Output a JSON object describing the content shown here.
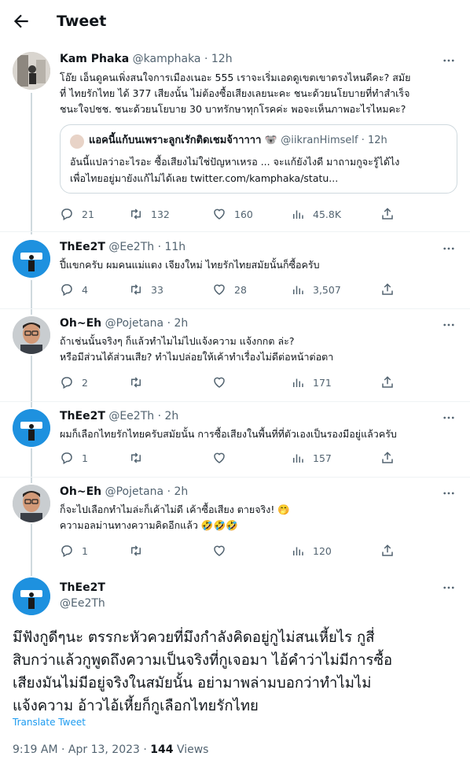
{
  "header": {
    "title": "Tweet"
  },
  "tweets": [
    {
      "name": "Kam Phaka",
      "handle": "@kamphaka",
      "time": "12h",
      "lines": [
        "โอ๊ย เอ็นดูคนเพิ่งสนใจการเมืองเนอะ 555 เราจะเริ่มเอดดูเขตเขาตรงไหนดีคะ? สมัย",
        "ที่ ไทยรักไทย ได้ 377 เสียงนั้น ไม่ต้องซื้อเสียงเลยนะคะ ชนะด้วยนโยบายที่ทำสำเร็จ",
        "ชนะใจปชช. ชนะด้วยนโยบาย 30 บาทรักษาทุกโรคค่ะ พอจะเห็นภาพอะไรไหมคะ?"
      ],
      "quote": {
        "name": "แอคนี้แก้บนเพราะลูกเรักติดเชมจ้าาาาา 🐨",
        "handle": "@iikranHimself",
        "time": "12h",
        "lines": [
          "อันนี้แปลว่าอะไรอะ ซื้อเสียงไม่ใช่ปัญหาเหรอ ... จะแก้ยังไงดี มาถามกูจะรู้ได้ไง",
          "เพื่อไทยอยู่มายังแก้ไม่ได้เลย twitter.com/kamphaka/statu..."
        ]
      },
      "replies": "21",
      "retweets": "132",
      "likes": "160",
      "views": "45.8K"
    },
    {
      "name": "ThEe2T",
      "handle": "@Ee2Th",
      "time": "11h",
      "lines": [
        "ปี้แขกครับ ผมคนแม่แตง เจียงใหม่ ไทยรักไทยสมัยนั้นก็ซื้อครับ"
      ],
      "replies": "4",
      "retweets": "33",
      "likes": "28",
      "views": "3,507"
    },
    {
      "name": "Oh~Eh",
      "handle": "@Pojetana",
      "time": "2h",
      "lines": [
        "ถ้าเช่นนั้นจริงๆ ก็แล้วทำไมไม่ไปแจ้งความ แจ้งกกต ล่ะ?",
        "หรือมีส่วนได้ส่วนเสีย? ทำไมปล่อยให้เค้าทำเรื่องไม่ดีต่อหน้าต่อตา"
      ],
      "replies": "2",
      "retweets": "",
      "likes": "",
      "views": "171"
    },
    {
      "name": "ThEe2T",
      "handle": "@Ee2Th",
      "time": "2h",
      "lines": [
        "ผมก็เลือกไทยรักไทยครับสมัยนั้น การซื้อเสียงในพื้นที่ที่ตัวเองเป็นรองมีอยู่แล้วครับ"
      ],
      "replies": "1",
      "retweets": "",
      "likes": "",
      "views": "157"
    },
    {
      "name": "Oh~Eh",
      "handle": "@Pojetana",
      "time": "2h",
      "lines": [
        "ก็จะไปเลือกทำไมล่ะก็เค้าไม่ดี เค้าซื้อเสียง ตายจริง! 🤭",
        "ความอลม่านทางความคิดอีกแล้ว 🤣🤣🤣"
      ],
      "replies": "1",
      "retweets": "",
      "likes": "",
      "views": "120"
    }
  ],
  "main": {
    "name": "ThEe2T",
    "handle": "@Ee2Th",
    "lines": [
      "มึฟังกูดีๆนะ ตรรกะหัวควยที่มึงกำลังคิดอยู่กูไม่สนเหี้ยไร กูสี่",
      "สิบกว่าแล้วกูพูดถึงความเป็นจริงที่กูเจอมา ไอ้คำว่าไม่มีการซื้อ",
      "เสียงมันไม่มีอยู่จริงในสมัยนั้น อย่ามาพล่ามบอกว่าทำไมไม่",
      "แจ้งความ อ้าวไอ้เหี้ยก็กูเลือกไทยรักไทย"
    ],
    "translate": "Translate Tweet",
    "timestamp": "9:19 AM · Apr 13, 2023 · ",
    "views_count": "144",
    "views_label": " Views"
  },
  "icons": [
    "back-arrow-icon",
    "more-icon",
    "reply-icon",
    "retweet-icon",
    "like-icon",
    "views-icon",
    "share-icon"
  ],
  "colors": {
    "text": "#0f1419",
    "muted": "#536471",
    "link": "#1d9bf0",
    "border": "#cfd9de"
  }
}
